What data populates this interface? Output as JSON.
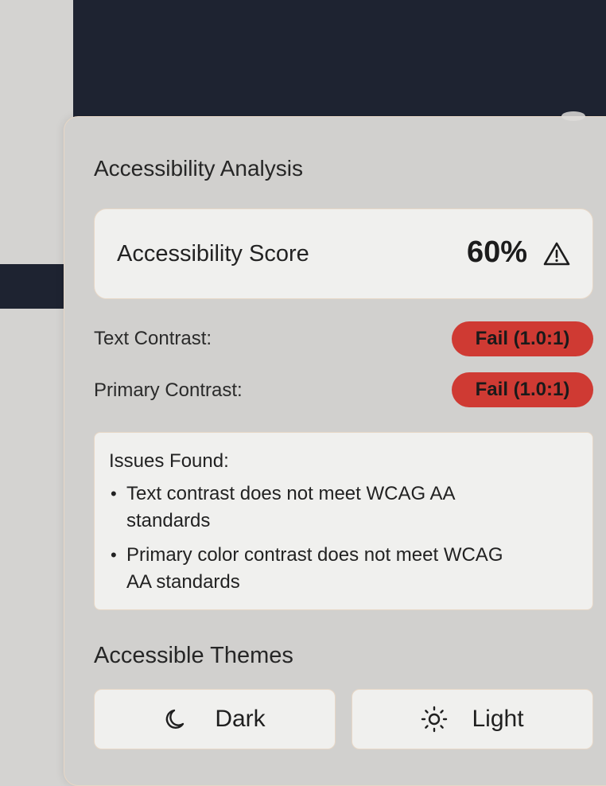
{
  "panel": {
    "title": "Accessibility Analysis",
    "score": {
      "label": "Accessibility Score",
      "value": "60%",
      "icon": "warning-triangle-icon"
    },
    "contrast_rows": [
      {
        "label": "Text Contrast:",
        "badge": "Fail (1.0:1)"
      },
      {
        "label": "Primary Contrast:",
        "badge": "Fail (1.0:1)"
      }
    ],
    "issues": {
      "title": "Issues Found:",
      "items": [
        "Text contrast does not meet WCAG AA",
        "standards",
        "Primary color contrast does not meet WCAG",
        "AA standards"
      ]
    },
    "themes": {
      "title": "Accessible Themes",
      "buttons": [
        {
          "label": "Dark",
          "icon": "moon-icon"
        },
        {
          "label": "Light",
          "icon": "sun-icon"
        }
      ]
    }
  },
  "colors": {
    "dark_background": "#1e2331",
    "fail_badge": "#cf3a33",
    "card_border": "#e7d7c6"
  }
}
